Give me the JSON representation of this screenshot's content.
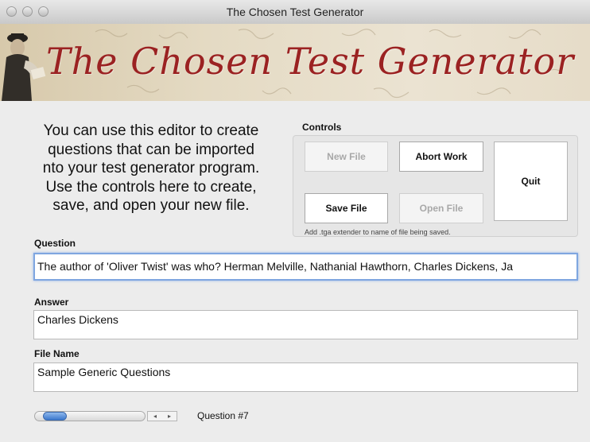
{
  "window": {
    "title": "The Chosen Test Generator"
  },
  "banner": {
    "title": "The Chosen Test Generator"
  },
  "intro": {
    "lines": [
      "You can use this editor to create",
      "questions that can be imported",
      "nto your test generator program.",
      "Use the controls here to create,",
      "save, and open your new file."
    ]
  },
  "controls": {
    "label": "Controls",
    "new_file": "New File",
    "abort_work": "Abort Work",
    "quit": "Quit",
    "save_file": "Save File",
    "open_file": "Open File",
    "hint": "Add .tga extender to name of file being saved."
  },
  "question": {
    "label": "Question",
    "value": "The author of 'Oliver Twist' was who? Herman Melville, Nathanial Hawthorn, Charles Dickens, Ja"
  },
  "answer": {
    "label": "Answer",
    "value": "Charles Dickens"
  },
  "file_name": {
    "label": "File Name",
    "value": "Sample Generic Questions"
  },
  "navigator": {
    "counter": "Question #7",
    "prev_glyph": "◂",
    "next_glyph": "▸"
  },
  "colors": {
    "banner_title": "#9b2222",
    "focus_ring": "#7fa6e0",
    "scroll_thumb": "#3c78cd"
  }
}
